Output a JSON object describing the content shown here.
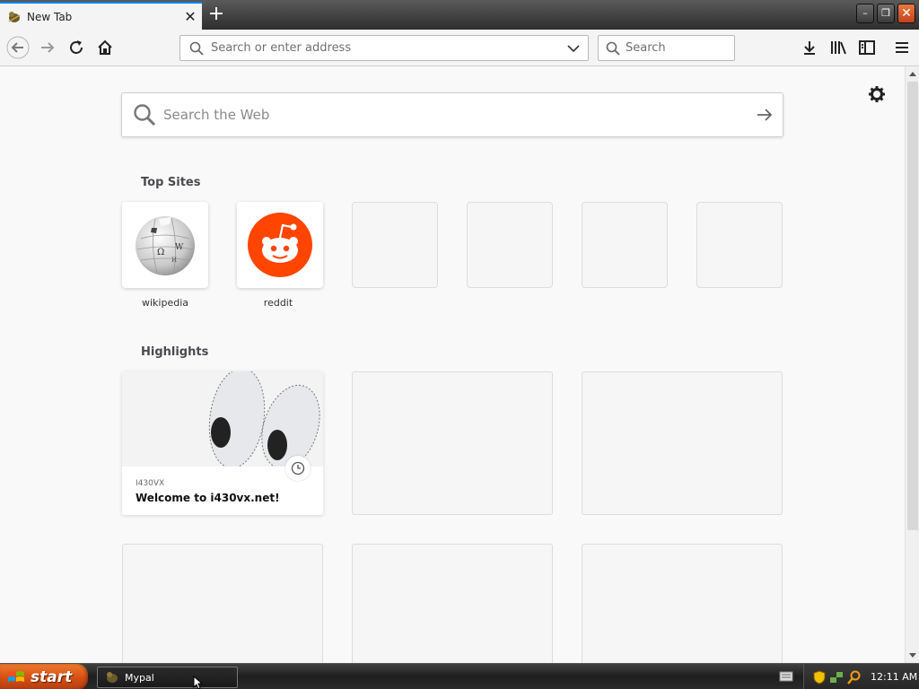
{
  "browser": {
    "tab": {
      "title": "New Tab"
    },
    "urlbar": {
      "placeholder": "Search or enter address"
    },
    "searchbar": {
      "placeholder": "Search"
    }
  },
  "newtab": {
    "web_search": {
      "placeholder": "Search the Web"
    },
    "top_sites": {
      "title": "Top Sites",
      "sites": [
        {
          "label": "wikipedia",
          "icon": "wikipedia-globe-icon"
        },
        {
          "label": "reddit",
          "icon": "reddit-alien-icon"
        }
      ]
    },
    "highlights": {
      "title": "Highlights",
      "cards": [
        {
          "host": "I430VX",
          "title": "Welcome to i430vx.net!"
        }
      ]
    }
  },
  "taskbar": {
    "start_label": "start",
    "task": {
      "label": "Mypal"
    },
    "clock": "12:11 AM"
  },
  "colors": {
    "accent": "#0a84ff",
    "reddit": "#ff4500",
    "start": "#d44e14"
  }
}
